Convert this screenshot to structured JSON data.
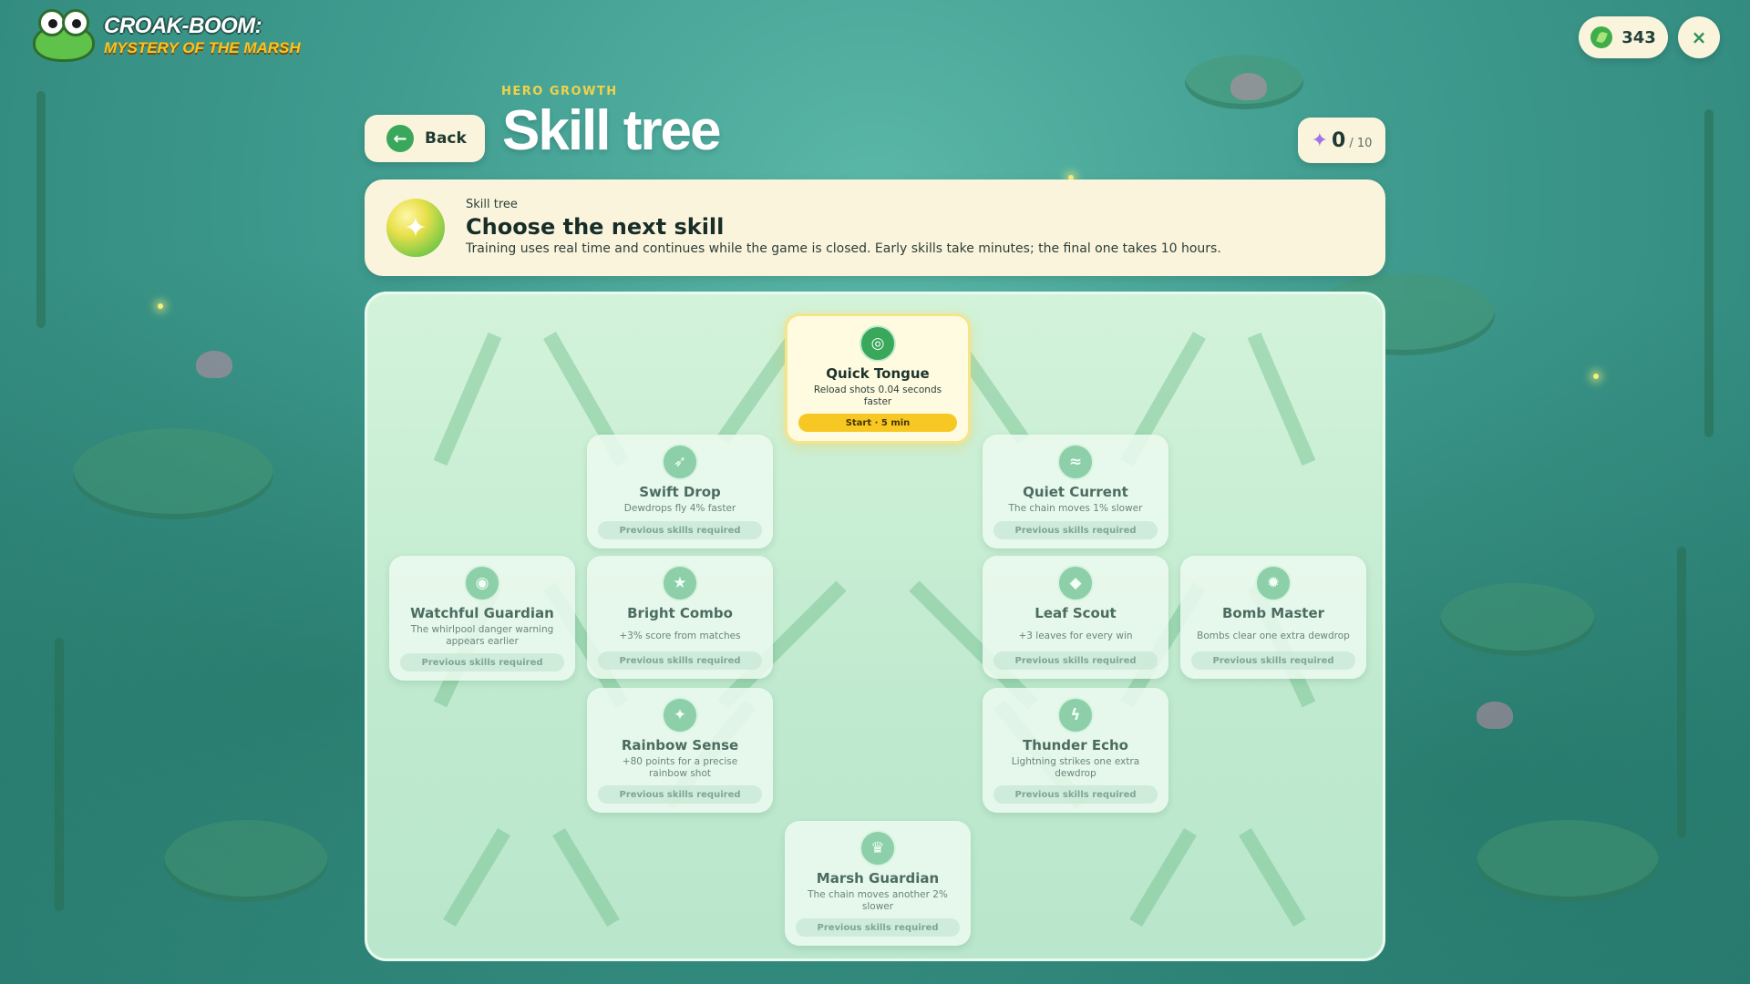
{
  "app": {
    "logo_line1": "CROAK-BOOM:",
    "logo_line2": "MYSTERY OF THE MARSH"
  },
  "header": {
    "subtitle": "HERO GROWTH",
    "title": "Skill tree",
    "back_label": "Back",
    "coins": "343",
    "close_icon": "×",
    "points_current": "0",
    "points_max": "/ 10"
  },
  "banner": {
    "kicker": "Skill tree",
    "title": "Choose the next skill",
    "description": "Training uses real time and continues while the game is closed. Early skills take minutes; the final one takes 10 hours."
  },
  "skills": [
    {
      "id": "quick-tongue",
      "name": "Quick Tongue",
      "description": "Reload shots 0.04 seconds faster",
      "status": "Start · 5 min",
      "icon": "target-icon",
      "glyph": "◎",
      "state": "available"
    },
    {
      "id": "swift-drop",
      "name": "Swift Drop",
      "description": "Dewdrops fly 4% faster",
      "status": "Previous skills required",
      "icon": "arrow-icon",
      "glyph": "➶",
      "state": "locked"
    },
    {
      "id": "quiet-current",
      "name": "Quiet Current",
      "description": "The chain moves 1% slower",
      "status": "Previous skills required",
      "icon": "wave-icon",
      "glyph": "≈",
      "state": "locked"
    },
    {
      "id": "watchful-guardian",
      "name": "Watchful Guardian",
      "description": "The whirlpool danger warning appears earlier",
      "status": "Previous skills required",
      "icon": "eye-icon",
      "glyph": "◉",
      "state": "locked"
    },
    {
      "id": "bright-combo",
      "name": "Bright Combo",
      "description": "+3% score from matches",
      "status": "Previous skills required",
      "icon": "star-icon",
      "glyph": "★",
      "state": "locked"
    },
    {
      "id": "leaf-scout",
      "name": "Leaf Scout",
      "description": "+3 leaves for every win",
      "status": "Previous skills required",
      "icon": "leaf-icon",
      "glyph": "◆",
      "state": "locked"
    },
    {
      "id": "bomb-master",
      "name": "Bomb Master",
      "description": "Bombs clear one extra dewdrop",
      "status": "Previous skills required",
      "icon": "burst-icon",
      "glyph": "✹",
      "state": "locked"
    },
    {
      "id": "rainbow-sense",
      "name": "Rainbow Sense",
      "description": "+80 points for a precise rainbow shot",
      "status": "Previous skills required",
      "icon": "sparkle-icon",
      "glyph": "✦",
      "state": "locked"
    },
    {
      "id": "thunder-echo",
      "name": "Thunder Echo",
      "description": "Lightning strikes one extra dewdrop",
      "status": "Previous skills required",
      "icon": "lightning-icon",
      "glyph": "ϟ",
      "state": "locked"
    },
    {
      "id": "marsh-guardian",
      "name": "Marsh Guardian",
      "description": "The chain moves another 2% slower",
      "status": "Previous skills required",
      "icon": "crown-icon",
      "glyph": "♛",
      "state": "locked"
    }
  ],
  "colors": {
    "accent_gold": "#f7c824",
    "accent_green": "#3aa85a",
    "card_locked": "#ecfaf0",
    "panel_bg": "#c8eed4"
  }
}
